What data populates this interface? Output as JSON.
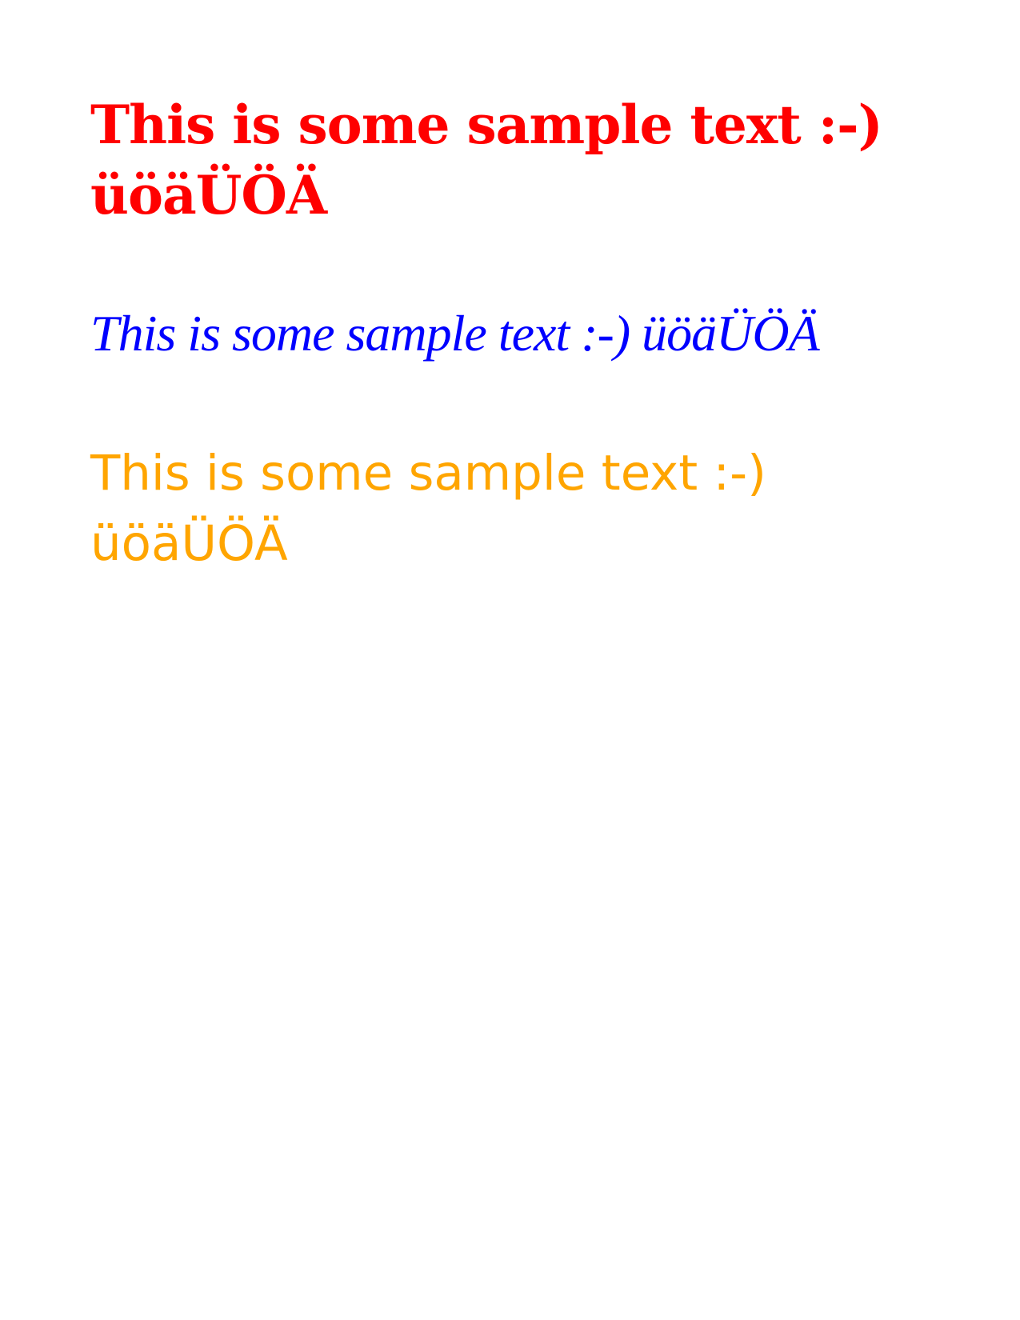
{
  "samples": [
    {
      "lines": [
        "This is some sample text :-)",
        "üöäÜÖÄ"
      ],
      "color": "#ff0000",
      "style": "heavy slab serif"
    },
    {
      "text": "This is some sample text :-) üöäÜÖÄ",
      "color": "#0000ff",
      "style": "script"
    },
    {
      "lines": [
        "This is some sample text :-)",
        "üöäÜÖÄ"
      ],
      "color": "#ffa500",
      "style": "light serif"
    }
  ]
}
